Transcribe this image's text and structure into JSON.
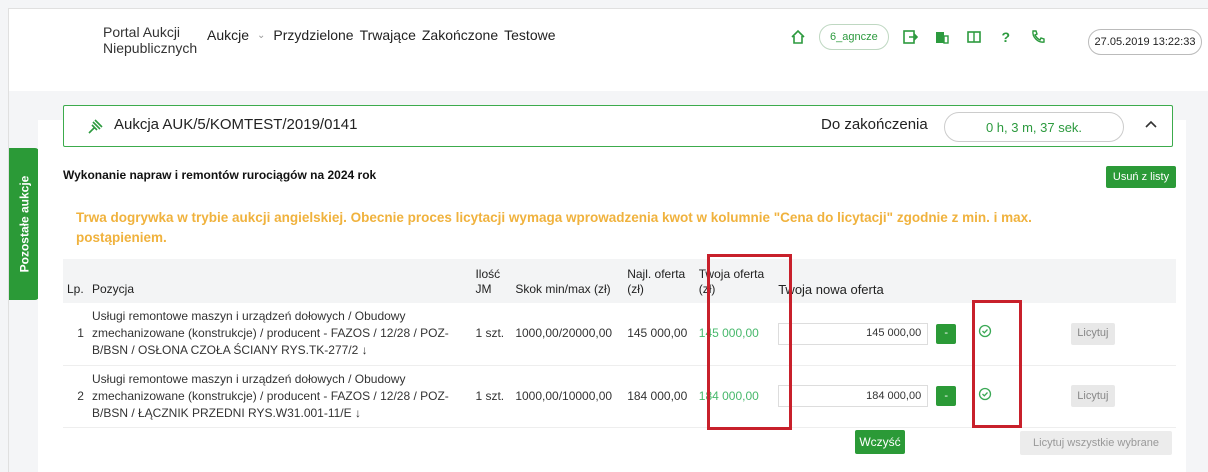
{
  "nav": {
    "logo_line1": "Portal Aukcji",
    "logo_line2": "Niepublicznych",
    "menu": [
      "Aukcje",
      "Przydzielone",
      "Trwające",
      "Zakończone",
      "Testowe"
    ],
    "username": "6_agncze",
    "datetime": "27.05.2019 13:22:33"
  },
  "side_tab": "Pozostałe aukcje",
  "auction": {
    "title": "Aukcja AUK/5/KOMTEST/2019/0141",
    "remaining_label": "Do zakończenia",
    "remaining_value": "0 h, 3 m, 37 sek."
  },
  "subject": "Wykonanie napraw i remontów rurociągów na 2024 rok",
  "remove_button": "Usuń z listy",
  "notice": "Trwa dogrywka w trybie aukcji angielskiej. Obecnie proces licytacji wymaga wprowadzenia kwot w kolumnie \"Cena do licytacji\" zgodnie z min. i max. postąpieniem.",
  "table": {
    "headers": {
      "lp": "Lp.",
      "pos": "Pozycja",
      "qty": "Ilość JM",
      "step": "Skok min/max (zł)",
      "best": "Najl. oferta (zł)",
      "your": "Twoja oferta (zł)",
      "new": "Twoja nowa oferta"
    },
    "rows": [
      {
        "lp": "1",
        "pos": "Usługi remontowe maszyn i urządzeń dołowych / Obudowy zmechanizowane (konstrukcje) / producent - FAZOS / 12/28 / POZ-B/BSN / OSŁONA CZOŁA ŚCIANY RYS.TK-277/2 ↓",
        "qty": "1 szt.",
        "step": "1000,00/20000,00",
        "best": "145 000,00",
        "your": "145 000,00",
        "new": "145 000,00",
        "minus": "-",
        "bid": "Licytuj"
      },
      {
        "lp": "2",
        "pos": "Usługi remontowe maszyn i urządzeń dołowych / Obudowy zmechanizowane (konstrukcje) / producent - FAZOS / 12/28 / POZ-B/BSN / ŁĄCZNIK PRZEDNI RYS.W31.001-11/E ↓",
        "qty": "1 szt.",
        "step": "1000,00/10000,00",
        "best": "184 000,00",
        "your": "184 000,00",
        "new": "184 000,00",
        "minus": "-",
        "bid": "Licytuj"
      }
    ]
  },
  "clear_button": "Wczyść",
  "bid_all_button": "Licytuj wszystkie wybrane",
  "colors": {
    "accent": "#2b9a37",
    "notice": "#f0b23d",
    "highlight": "#c8202b"
  }
}
